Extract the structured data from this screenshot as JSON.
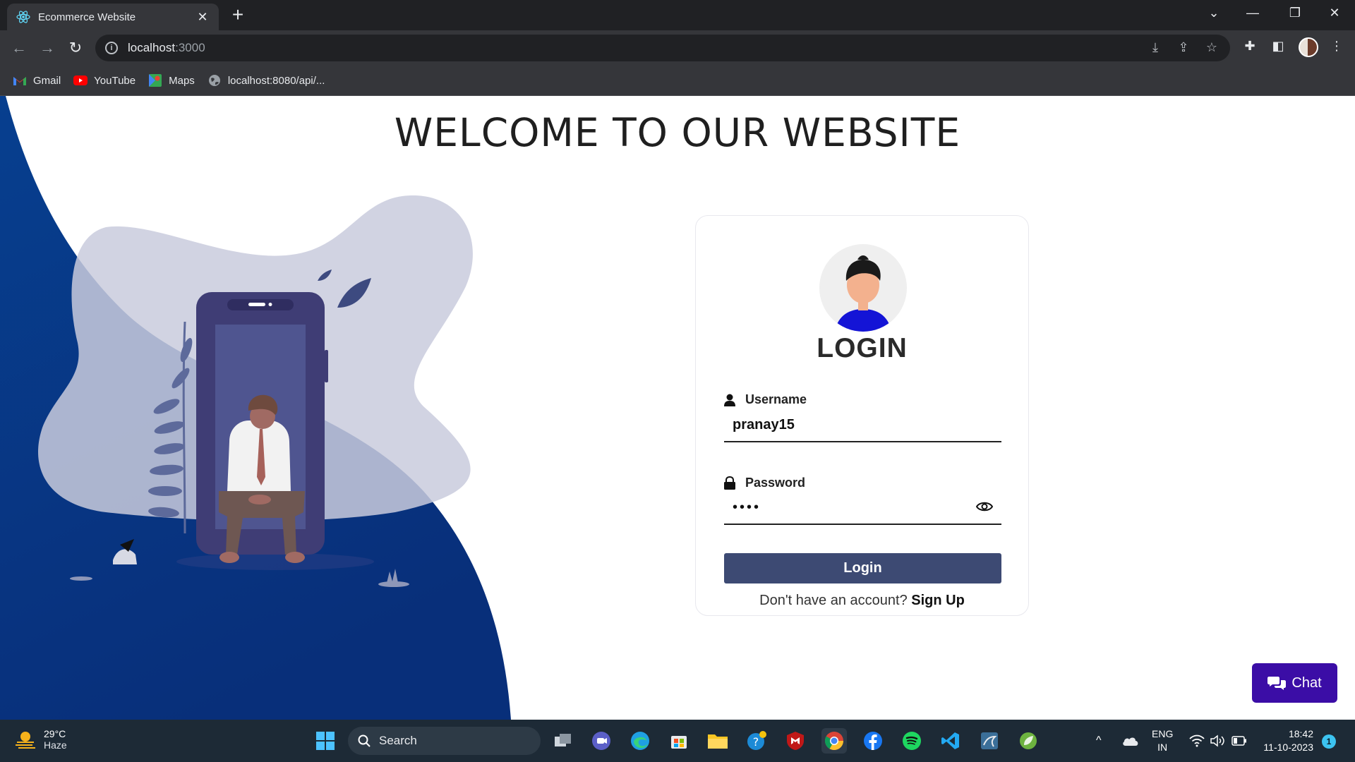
{
  "browser": {
    "tab_title": "Ecommerce Website",
    "url_host": "localhost",
    "url_port": ":3000",
    "bookmarks": [
      {
        "label": "Gmail",
        "icon": "gmail-icon"
      },
      {
        "label": "YouTube",
        "icon": "youtube-icon"
      },
      {
        "label": "Maps",
        "icon": "maps-icon"
      },
      {
        "label": "localhost:8080/api/...",
        "icon": "globe-icon"
      }
    ]
  },
  "page": {
    "title": "WELCOME TO OUR WEBSITE",
    "login": {
      "heading": "LOGIN",
      "username_label": "Username",
      "username_value": "pranay15",
      "password_label": "Password",
      "password_value": "••••",
      "button_label": "Login",
      "signup_prompt": "Don't have an account?",
      "signup_link": "Sign Up"
    },
    "chat_label": "Chat"
  },
  "taskbar": {
    "weather_temp": "29°C",
    "weather_desc": "Haze",
    "search_label": "Search",
    "lang_line1": "ENG",
    "lang_line2": "IN",
    "time": "18:42",
    "date": "11-10-2023",
    "notification_count": "1"
  },
  "colors": {
    "accent_login_button": "#3d4a73",
    "chat_button": "#3b0da6",
    "wave_blue": "#0a3a86",
    "blob_gray": "#c9cbdd"
  }
}
